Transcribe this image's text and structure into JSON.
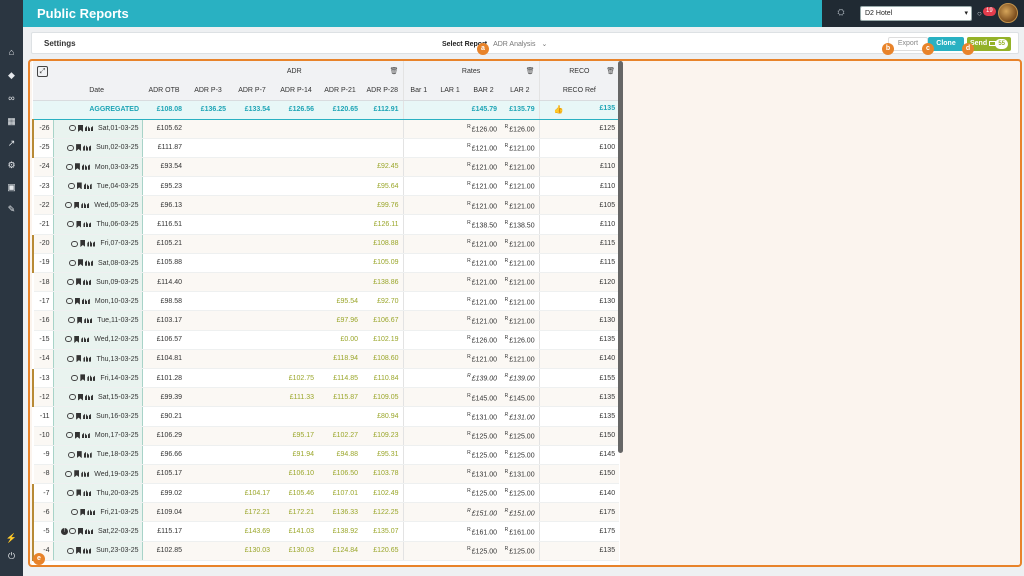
{
  "app": {
    "title": "Public Reports"
  },
  "leftnav": {
    "icons": [
      "home-icon",
      "diamond-icon",
      "binoculars-icon",
      "grid-icon",
      "trend-icon",
      "gear-icon",
      "map-icon",
      "wrench-icon"
    ],
    "bottom_icons": [
      "plug-icon",
      "power-icon"
    ]
  },
  "topbar": {
    "hotel_select": "D2 Hotel",
    "notification_count": "19"
  },
  "settings": {
    "label": "Settings",
    "select_report_label": "Select Report",
    "select_report_value": "ADR Analysis",
    "export_label": "Export",
    "clone_label": "Clone",
    "send_label": "Send",
    "send_count": "55"
  },
  "markers": {
    "a": "a",
    "b": "b",
    "c": "c",
    "d": "d",
    "e": "e"
  },
  "colors": {
    "accent": "#29b1c2",
    "highlight": "#e8832a",
    "send": "#94b228",
    "pickup": "#9aa62a"
  },
  "table": {
    "groups": {
      "adr": "ADR",
      "rates": "Rates",
      "reco": "RECO"
    },
    "columns": {
      "date": "Date",
      "adr_otb": "ADR OTB",
      "adr_p3": "ADR P-3",
      "adr_p7": "ADR P-7",
      "adr_p14": "ADR P-14",
      "adr_p21": "ADR P-21",
      "adr_p28": "ADR P-28",
      "bar1": "Bar 1",
      "lar1": "LAR 1",
      "bar2": "BAR 2",
      "lar2": "LAR 2",
      "reco_ref": "RECO Ref"
    },
    "aggregated": {
      "label": "AGGREGATED",
      "adr_otb": "£108.08",
      "adr_p3": "£136.25",
      "adr_p7": "£133.54",
      "adr_p14": "£126.56",
      "adr_p21": "£120.65",
      "adr_p28": "£112.91",
      "bar2": "£145.79",
      "lar2": "£135.79",
      "reco_ref": "£135"
    },
    "rows": [
      {
        "lead": "-26",
        "date": "Sat,01-03-25",
        "otb": "£105.62",
        "p3": "",
        "p7": "",
        "p14": "",
        "p21": "",
        "p28": "",
        "bar2": "£126.00",
        "lar2": "£126.00",
        "reco": "£125",
        "wk": true
      },
      {
        "lead": "-25",
        "date": "Sun,02-03-25",
        "otb": "£111.87",
        "p3": "",
        "p7": "",
        "p14": "",
        "p21": "",
        "p28": "",
        "bar2": "£121.00",
        "lar2": "£121.00",
        "reco": "£100",
        "wk": true
      },
      {
        "lead": "-24",
        "date": "Mon,03-03-25",
        "otb": "£93.54",
        "p3": "",
        "p7": "",
        "p14": "",
        "p21": "",
        "p28": "£92.45",
        "bar2": "£121.00",
        "lar2": "£121.00",
        "reco": "£110",
        "wk": false
      },
      {
        "lead": "-23",
        "date": "Tue,04-03-25",
        "otb": "£95.23",
        "p3": "",
        "p7": "",
        "p14": "",
        "p21": "",
        "p28": "£95.64",
        "bar2": "£121.00",
        "lar2": "£121.00",
        "reco": "£110",
        "wk": false
      },
      {
        "lead": "-22",
        "date": "Wed,05-03-25",
        "otb": "£96.13",
        "p3": "",
        "p7": "",
        "p14": "",
        "p21": "",
        "p28": "£99.76",
        "bar2": "£121.00",
        "lar2": "£121.00",
        "reco": "£105",
        "wk": false
      },
      {
        "lead": "-21",
        "date": "Thu,06-03-25",
        "otb": "£116.51",
        "p3": "",
        "p7": "",
        "p14": "",
        "p21": "",
        "p28": "£126.11",
        "bar2": "£138.50",
        "lar2": "£138.50",
        "reco": "£110",
        "wk": false
      },
      {
        "lead": "-20",
        "date": "Fri,07-03-25",
        "otb": "£105.21",
        "p3": "",
        "p7": "",
        "p14": "",
        "p21": "",
        "p28": "£108.88",
        "bar2": "£121.00",
        "lar2": "£121.00",
        "reco": "£115",
        "wk": true
      },
      {
        "lead": "-19",
        "date": "Sat,08-03-25",
        "otb": "£105.88",
        "p3": "",
        "p7": "",
        "p14": "",
        "p21": "",
        "p28": "£105.09",
        "bar2": "£121.00",
        "lar2": "£121.00",
        "reco": "£115",
        "wk": true
      },
      {
        "lead": "-18",
        "date": "Sun,09-03-25",
        "otb": "£114.40",
        "p3": "",
        "p7": "",
        "p14": "",
        "p21": "",
        "p28": "£138.86",
        "bar2": "£121.00",
        "lar2": "£121.00",
        "reco": "£120",
        "wk": false
      },
      {
        "lead": "-17",
        "date": "Mon,10-03-25",
        "otb": "£98.58",
        "p3": "",
        "p7": "",
        "p14": "",
        "p21": "£95.54",
        "p28": "£92.70",
        "bar2": "£121.00",
        "lar2": "£121.00",
        "reco": "£130",
        "wk": false
      },
      {
        "lead": "-16",
        "date": "Tue,11-03-25",
        "otb": "£103.17",
        "p3": "",
        "p7": "",
        "p14": "",
        "p21": "£97.96",
        "p28": "£106.67",
        "bar2": "£121.00",
        "lar2": "£121.00",
        "reco": "£130",
        "wk": false
      },
      {
        "lead": "-15",
        "date": "Wed,12-03-25",
        "otb": "£106.57",
        "p3": "",
        "p7": "",
        "p14": "",
        "p21": "£0.00",
        "p28": "£102.19",
        "bar2": "£126.00",
        "lar2": "£126.00",
        "reco": "£135",
        "wk": false
      },
      {
        "lead": "-14",
        "date": "Thu,13-03-25",
        "otb": "£104.81",
        "p3": "",
        "p7": "",
        "p14": "",
        "p21": "£118.94",
        "p28": "£108.60",
        "bar2": "£121.00",
        "lar2": "£121.00",
        "reco": "£140",
        "wk": false
      },
      {
        "lead": "-13",
        "date": "Fri,14-03-25",
        "otb": "£101.28",
        "p3": "",
        "p7": "",
        "p14": "£102.75",
        "p21": "£114.85",
        "p28": "£110.84",
        "bar2": "£139.00",
        "lar2": "£139.00",
        "reco": "£155",
        "wk": true,
        "it": true
      },
      {
        "lead": "-12",
        "date": "Sat,15-03-25",
        "otb": "£99.39",
        "p3": "",
        "p7": "",
        "p14": "£111.33",
        "p21": "£115.87",
        "p28": "£109.05",
        "bar2": "£145.00",
        "lar2": "£145.00",
        "reco": "£135",
        "wk": true
      },
      {
        "lead": "-11",
        "date": "Sun,16-03-25",
        "otb": "£90.21",
        "p3": "",
        "p7": "",
        "p14": "",
        "p21": "",
        "p28": "£80.94",
        "bar2": "£131.00",
        "lar2": "£131.00",
        "reco": "£135",
        "wk": false,
        "itl": true
      },
      {
        "lead": "-10",
        "date": "Mon,17-03-25",
        "otb": "£106.29",
        "p3": "",
        "p7": "",
        "p14": "£95.17",
        "p21": "£102.27",
        "p28": "£109.23",
        "bar2": "£125.00",
        "lar2": "£125.00",
        "reco": "£150",
        "wk": false
      },
      {
        "lead": "-9",
        "date": "Tue,18-03-25",
        "otb": "£96.66",
        "p3": "",
        "p7": "",
        "p14": "£91.94",
        "p21": "£94.88",
        "p28": "£95.31",
        "bar2": "£125.00",
        "lar2": "£125.00",
        "reco": "£145",
        "wk": false
      },
      {
        "lead": "-8",
        "date": "Wed,19-03-25",
        "otb": "£105.17",
        "p3": "",
        "p7": "",
        "p14": "£106.10",
        "p21": "£106.50",
        "p28": "£103.78",
        "bar2": "£131.00",
        "lar2": "£131.00",
        "reco": "£150",
        "wk": false
      },
      {
        "lead": "-7",
        "date": "Thu,20-03-25",
        "otb": "£99.02",
        "p3": "",
        "p7": "£104.17",
        "p14": "£105.46",
        "p21": "£107.01",
        "p28": "£102.49",
        "bar2": "£125.00",
        "lar2": "£125.00",
        "reco": "£140",
        "wk": true
      },
      {
        "lead": "-6",
        "date": "Fri,21-03-25",
        "otb": "£109.04",
        "p3": "",
        "p7": "£172.21",
        "p14": "£172.21",
        "p21": "£136.33",
        "p28": "£122.25",
        "bar2": "£151.00",
        "lar2": "£151.00",
        "reco": "£175",
        "wk": true,
        "itb": true
      },
      {
        "lead": "-5",
        "date": "Sat,22-03-25",
        "otb": "£115.17",
        "p3": "",
        "p7": "£143.69",
        "p14": "£141.03",
        "p21": "£138.92",
        "p28": "£135.07",
        "bar2": "£161.00",
        "lar2": "£161.00",
        "reco": "£175",
        "wk": true,
        "warn": true
      },
      {
        "lead": "-4",
        "date": "Sun,23-03-25",
        "otb": "£102.85",
        "p3": "",
        "p7": "£130.03",
        "p14": "£130.03",
        "p21": "£124.84",
        "p28": "£120.65",
        "bar2": "£125.00",
        "lar2": "£125.00",
        "reco": "£135",
        "wk": true
      }
    ]
  }
}
